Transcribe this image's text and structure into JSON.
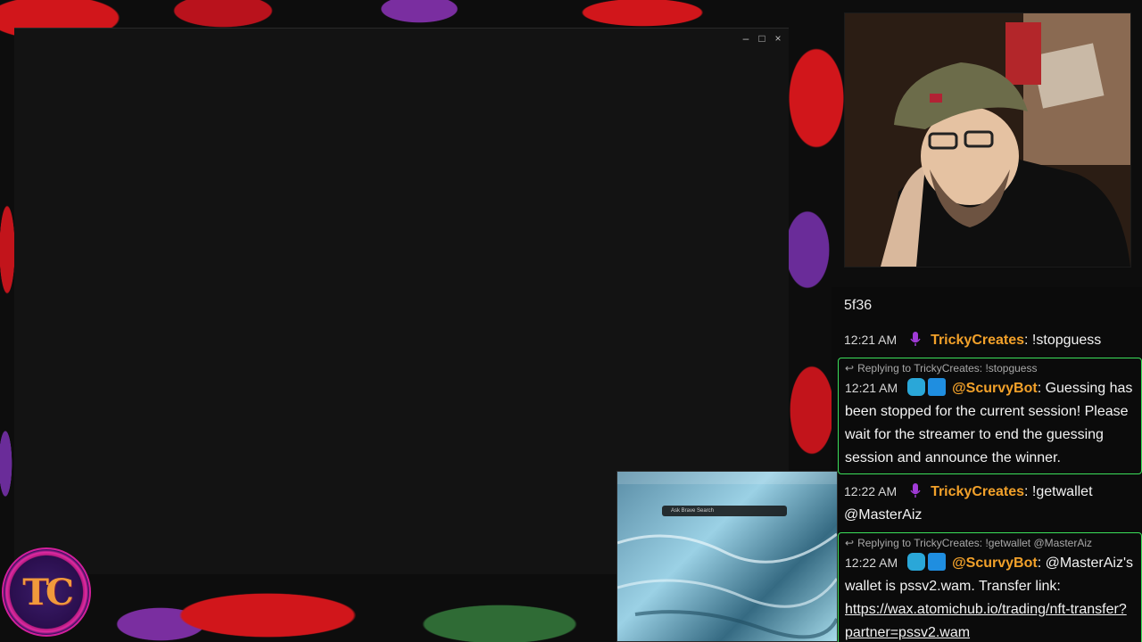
{
  "window": {
    "controls": {
      "minimize": "–",
      "maximize": "□",
      "close": "×"
    }
  },
  "chat": {
    "partial_top": "5f36",
    "messages": [
      {
        "time": "12:21 AM",
        "user": "TrickyCreates",
        "text": "!stopguess",
        "badges": [
          "microphone-icon"
        ]
      },
      {
        "reply_to": "Replying to TrickyCreates: !stopguess",
        "time": "12:21 AM",
        "user": "@ScurvyBot",
        "text": "Guessing has been stopped for the current session! Please wait for the streamer to end the guessing session and announce the winner.",
        "badges": [
          "robot-icon",
          "mod-icon"
        ]
      },
      {
        "time": "12:22 AM",
        "user": "TrickyCreates",
        "text": "!getwallet @MasterAiz",
        "badges": [
          "microphone-icon"
        ]
      },
      {
        "reply_to": "Replying to TrickyCreates: !getwallet @MasterAiz",
        "time": "12:22 AM",
        "user": "@ScurvyBot",
        "text": "@MasterAiz's wallet is pssv2.wam. Transfer link:",
        "link": "https://wax.atomichub.io/trading/nft-transfer?partner=pssv2.wam",
        "badges": [
          "robot-icon",
          "mod-icon"
        ]
      }
    ]
  },
  "logo": {
    "letters": "TC"
  },
  "preview": {
    "search_placeholder": "Ask Brave Search"
  },
  "colors": {
    "username": "#f2a12a",
    "reply_border": "#3bdf5a",
    "accent_red": "#d1161b",
    "accent_purple": "#7a2ea0"
  }
}
